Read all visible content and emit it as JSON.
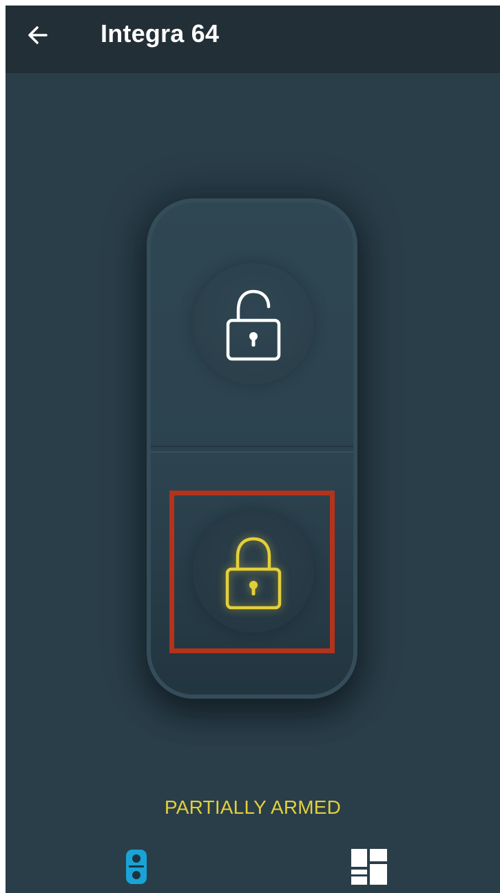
{
  "app_bar": {
    "title": "Integra 64",
    "back_icon": "arrow-left-icon"
  },
  "switch": {
    "disarm_icon": "unlocked-padlock-icon",
    "arm_icon": "locked-padlock-icon",
    "selected": "arm"
  },
  "status": {
    "text": "PARTIALLY ARMED",
    "color": "#e3cf3a"
  },
  "bottom_nav": {
    "items": [
      {
        "icon": "keypad-switch-icon",
        "active": true
      },
      {
        "icon": "dashboard-grid-icon",
        "active": false
      }
    ]
  },
  "colors": {
    "background": "#2a3e49",
    "app_bar": "#232f36",
    "accent": "#1aa3d6",
    "armed": "#e3cf3a",
    "highlight": "#b3331b"
  }
}
